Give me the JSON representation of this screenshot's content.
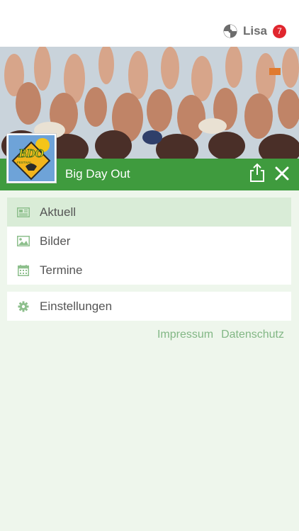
{
  "header": {
    "user_name": "Lisa",
    "notification_count": "7"
  },
  "title_bar": {
    "title": "Big Day Out",
    "logo_text": "BDO",
    "logo_subtext": "FESTIVAL"
  },
  "menu": {
    "items": [
      {
        "label": "Aktuell",
        "icon": "newspaper-icon",
        "active": true
      },
      {
        "label": "Bilder",
        "icon": "image-icon",
        "active": false
      },
      {
        "label": "Termine",
        "icon": "calendar-icon",
        "active": false
      }
    ],
    "settings_label": "Einstellungen"
  },
  "footer": {
    "impressum": "Impressum",
    "datenschutz": "Datenschutz"
  },
  "colors": {
    "accent": "#3f9b3e",
    "active_item_bg": "#d9ecd7",
    "background": "#eef6ec",
    "badge": "#e0262e",
    "link": "#82b785"
  }
}
